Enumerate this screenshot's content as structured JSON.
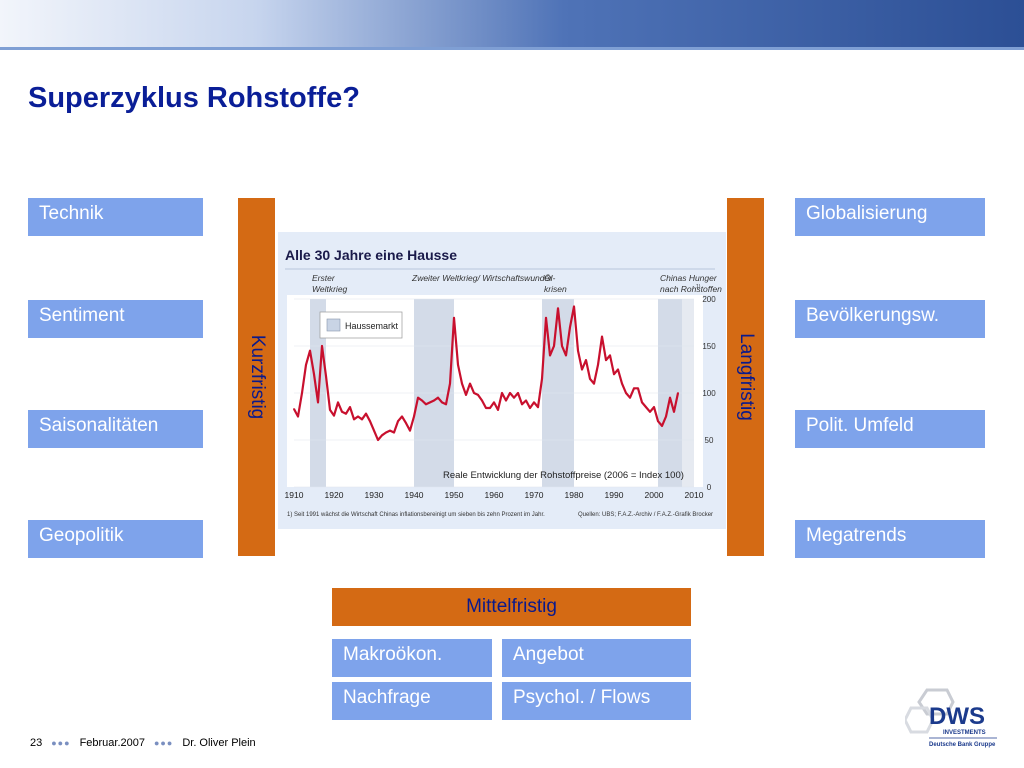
{
  "slide": {
    "title": "Superzyklus Rohstoffe?"
  },
  "left_boxes": [
    "Technik",
    "Sentiment",
    "Saisonalitäten",
    "Geopolitik"
  ],
  "right_boxes": [
    "Globalisierung",
    "Bevölkerungsw.",
    "Polit. Umfeld",
    "Megatrends"
  ],
  "bars": {
    "left_label": "Kurzfristig",
    "right_label": "Langfristig",
    "middle_label": "Mittelfristig"
  },
  "bottom_boxes": [
    "Makroökon.",
    "Angebot",
    "Nachfrage",
    "Psychol. / Flows"
  ],
  "footer": {
    "page": "23",
    "date": "Februar.2007",
    "author": "Dr. Oliver Plein"
  },
  "logo": {
    "brand": "DWS",
    "line": "INVESTMENTS",
    "group": "Deutsche Bank Gruppe"
  },
  "colors": {
    "title": "#0a1e97",
    "box": "#7ea3eb",
    "bar": "#d46a14",
    "line": "#c8102e"
  },
  "chart_data": {
    "type": "line",
    "title": "Alle 30 Jahre eine Hausse",
    "subtitle": "Reale Entwicklung der Rohstoffpreise (2006 = Index 100)",
    "legend": [
      "Haussemarkt"
    ],
    "period_labels": [
      "Erster Weltkrieg",
      "Zweiter Weltkrieg/ Wirtschaftswunder",
      "Öl- krisen",
      "Chinas Hunger nach Rohstoffen"
    ],
    "footnote_marker": "1)",
    "footnote": "1) Seit 1991 wächst die Wirtschaft Chinas inflationsbereinigt um sieben bis zehn Prozent im Jahr.",
    "source": "Quellen: UBS; F.A.Z.-Archiv / F.A.Z.-Grafik Brocker",
    "x_ticks": [
      "1910",
      "1920",
      "1930",
      "1940",
      "1950",
      "1960",
      "1970",
      "1980",
      "1990",
      "2000",
      "2010"
    ],
    "y_ticks": [
      "200",
      "150",
      "100",
      "50",
      "0"
    ],
    "xlim": [
      1910,
      2010
    ],
    "ylim": [
      0,
      200
    ],
    "hausse_periods": [
      [
        1914,
        1918
      ],
      [
        1940,
        1950
      ],
      [
        1972,
        1980
      ],
      [
        2001,
        2010
      ]
    ],
    "x": [
      1910,
      1911,
      1912,
      1913,
      1914,
      1915,
      1916,
      1917,
      1918,
      1919,
      1920,
      1921,
      1922,
      1923,
      1924,
      1925,
      1926,
      1927,
      1928,
      1929,
      1930,
      1931,
      1932,
      1933,
      1934,
      1935,
      1936,
      1937,
      1938,
      1939,
      1940,
      1941,
      1942,
      1943,
      1944,
      1945,
      1946,
      1947,
      1948,
      1949,
      1950,
      1951,
      1952,
      1953,
      1954,
      1955,
      1956,
      1957,
      1958,
      1959,
      1960,
      1961,
      1962,
      1963,
      1964,
      1965,
      1966,
      1967,
      1968,
      1969,
      1970,
      1971,
      1972,
      1973,
      1974,
      1975,
      1976,
      1977,
      1978,
      1979,
      1980,
      1981,
      1982,
      1983,
      1984,
      1985,
      1986,
      1987,
      1988,
      1989,
      1990,
      1991,
      1992,
      1993,
      1994,
      1995,
      1996,
      1997,
      1998,
      1999,
      2000,
      2001,
      2002,
      2003,
      2004,
      2005,
      2006
    ],
    "values": [
      83,
      75,
      100,
      130,
      145,
      120,
      90,
      150,
      118,
      82,
      76,
      90,
      80,
      78,
      85,
      72,
      75,
      72,
      78,
      70,
      60,
      50,
      55,
      58,
      60,
      58,
      70,
      75,
      68,
      60,
      75,
      95,
      92,
      88,
      90,
      92,
      95,
      90,
      88,
      110,
      180,
      130,
      110,
      98,
      110,
      100,
      98,
      92,
      84,
      84,
      90,
      82,
      100,
      92,
      100,
      95,
      100,
      88,
      92,
      84,
      90,
      85,
      115,
      180,
      140,
      150,
      190,
      150,
      140,
      170,
      192,
      145,
      125,
      135,
      115,
      110,
      130,
      160,
      135,
      140,
      120,
      125,
      110,
      100,
      95,
      105,
      105,
      90,
      85,
      80,
      85,
      70,
      65,
      75,
      95,
      80,
      100
    ]
  }
}
